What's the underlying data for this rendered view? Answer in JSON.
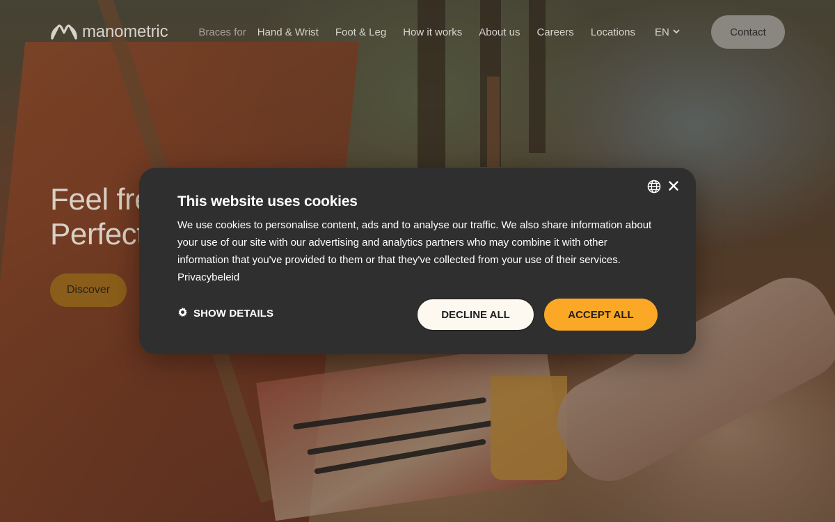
{
  "brand": {
    "name": "manometric",
    "logo_icon": "infinity-loop-icon"
  },
  "nav": {
    "items": [
      {
        "label": "Braces for",
        "muted": true
      },
      {
        "label": "Hand & Wrist"
      },
      {
        "label": "Foot & Leg"
      },
      {
        "label": "How it works"
      },
      {
        "label": "About us"
      },
      {
        "label": "Careers"
      },
      {
        "label": "Locations"
      }
    ],
    "language": "EN",
    "language_icon": "chevron-down-icon",
    "contact_label": "Contact"
  },
  "hero": {
    "title_line1": "Feel fre",
    "title_line2": "Perfect",
    "cta_label": "Discover"
  },
  "cookie_dialog": {
    "title": "This website uses cookies",
    "body": "We use cookies to personalise content, ads and to analyse our traffic. We also share information about your use of our site with our advertising and analytics partners who may combine it with other information that you've provided to them or that they've collected from your use of their services.",
    "privacy_link": "Privacybeleid",
    "show_details_label": "SHOW DETAILS",
    "decline_label": "DECLINE ALL",
    "accept_label": "ACCEPT ALL",
    "accept_color": "#fba826",
    "icons": {
      "language": "globe-icon",
      "close": "close-icon",
      "details": "gear-icon"
    }
  }
}
